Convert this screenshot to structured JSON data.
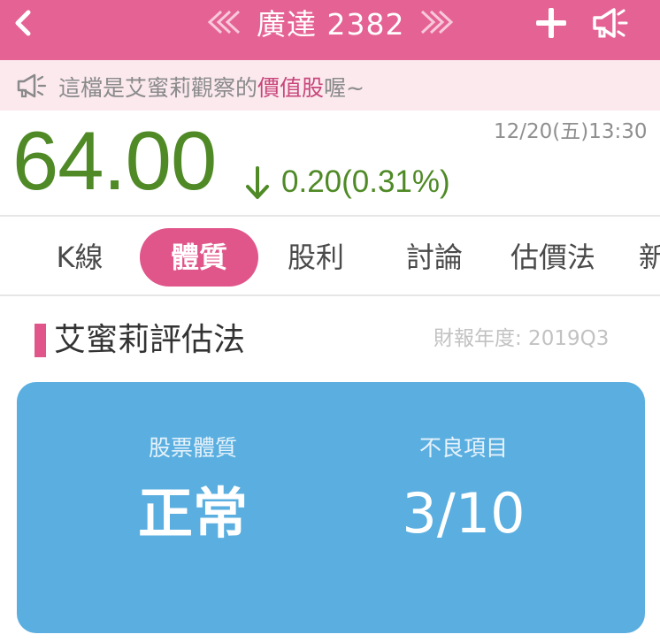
{
  "header": {
    "title": "廣達 2382",
    "icons": [
      "chevron-left-icon",
      "double-chevron-left-icon",
      "double-chevron-right-icon",
      "plus-icon",
      "megaphone-icon"
    ],
    "background_color": "#e56394"
  },
  "notice": {
    "text_before": "這檔是艾蜜莉觀察的",
    "highlight": "價值股",
    "text_after": "喔~",
    "highlight_color": "#c8467a"
  },
  "quote": {
    "price": "64.00",
    "change": "0.20(0.31%)",
    "direction": "down",
    "timestamp": "12/20(五)13:30",
    "color": "#4f8a26"
  },
  "tabs": [
    {
      "label": "K線",
      "active": false
    },
    {
      "label": "體質",
      "active": true
    },
    {
      "label": "股利",
      "active": false
    },
    {
      "label": "討論",
      "active": false
    },
    {
      "label": "估價法",
      "active": false
    },
    {
      "label": "新",
      "active": false
    }
  ],
  "section": {
    "title": "艾蜜莉評估法",
    "report_date": "財報年度: 2019Q3",
    "accent_color": "#e0558a"
  },
  "card": {
    "background_color": "#5aafe0",
    "left_label": "股票體質",
    "left_value": "正常",
    "right_label": "不良項目",
    "right_value": "3/10"
  }
}
